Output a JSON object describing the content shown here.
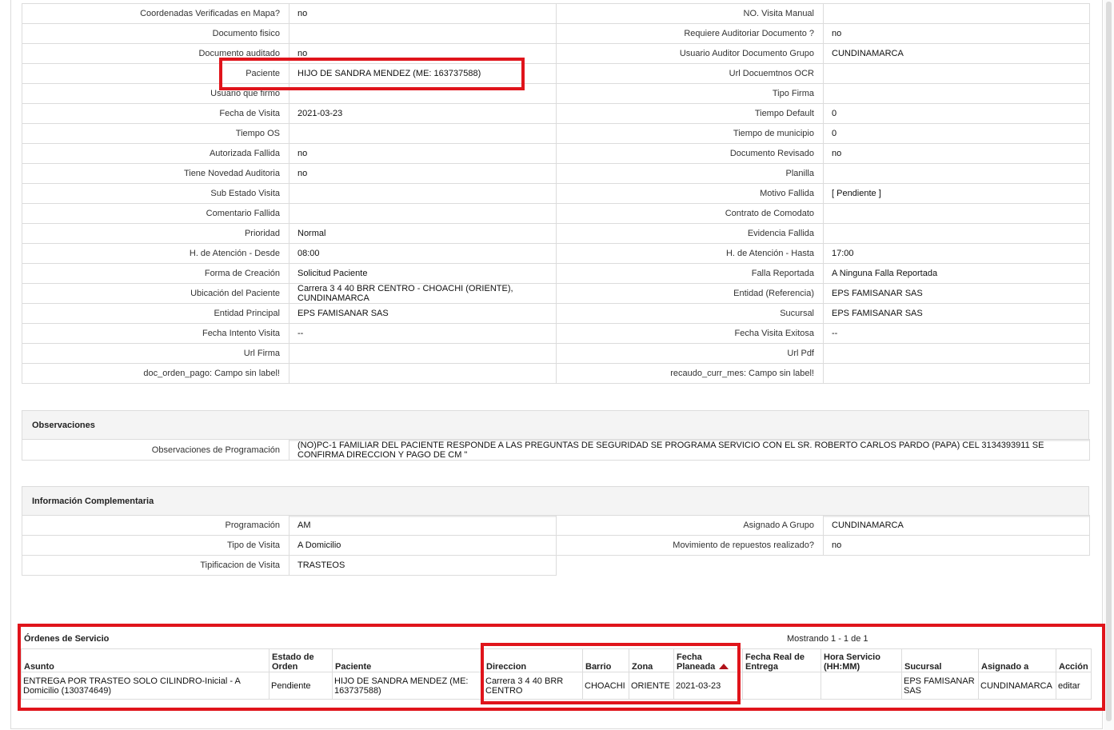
{
  "details": [
    {
      "l1": "Coordenadas Verificadas en Mapa?",
      "v1": "no",
      "l2": "NO. Visita Manual",
      "v2": ""
    },
    {
      "l1": "Documento fisico",
      "v1": "",
      "l2": "Requiere Auditoriar Documento ?",
      "v2": "no"
    },
    {
      "l1": "Documento auditado",
      "v1": "no",
      "l2": "Usuario Auditor Documento Grupo",
      "v2": "CUNDINAMARCA"
    },
    {
      "l1": "Paciente",
      "v1": "HIJO DE SANDRA MENDEZ (ME: 163737588)",
      "l2": "Url Docuemtnos OCR",
      "v2": ""
    },
    {
      "l1": "Usuario que firmo",
      "v1": "",
      "l2": "Tipo Firma",
      "v2": ""
    },
    {
      "l1": "Fecha de Visita",
      "v1": "2021-03-23",
      "l2": "Tiempo Default",
      "v2": "0"
    },
    {
      "l1": "Tiempo OS",
      "v1": "",
      "l2": "Tiempo de municipio",
      "v2": "0"
    },
    {
      "l1": "Autorizada Fallida",
      "v1": "no",
      "l2": "Documento Revisado",
      "v2": "no"
    },
    {
      "l1": "Tiene Novedad Auditoria",
      "v1": "no",
      "l2": "Planilla",
      "v2": ""
    },
    {
      "l1": "Sub Estado Visita",
      "v1": "",
      "l2": "Motivo Fallida",
      "v2": "[ Pendiente ]"
    },
    {
      "l1": "Comentario Fallida",
      "v1": "",
      "l2": "Contrato de Comodato",
      "v2": ""
    },
    {
      "l1": "Prioridad",
      "v1": "Normal",
      "l2": "Evidencia Fallida",
      "v2": ""
    },
    {
      "l1": "H. de Atención - Desde",
      "v1": "08:00",
      "l2": "H. de Atención - Hasta",
      "v2": "17:00"
    },
    {
      "l1": "Forma de Creación",
      "v1": "Solicitud Paciente",
      "l2": "Falla Reportada",
      "v2": "A Ninguna Falla Reportada"
    },
    {
      "l1": "Ubicación del Paciente",
      "v1": "Carrera 3 4 40 BRR CENTRO - CHOACHI (ORIENTE), CUNDINAMARCA",
      "l2": "Entidad (Referencia)",
      "v2": "EPS FAMISANAR SAS"
    },
    {
      "l1": "Entidad Principal",
      "v1": "EPS FAMISANAR SAS",
      "l2": "Sucursal",
      "v2": "EPS FAMISANAR SAS"
    },
    {
      "l1": "Fecha Intento Visita",
      "v1": "--",
      "l2": "Fecha Visita Exitosa",
      "v2": "--"
    },
    {
      "l1": "Url Firma",
      "v1": "",
      "l2": "Url Pdf",
      "v2": ""
    },
    {
      "l1": "doc_orden_pago: Campo sin label!",
      "v1": "",
      "l2": "recaudo_curr_mes: Campo sin label!",
      "v2": ""
    }
  ],
  "observaciones": {
    "title": "Observaciones",
    "label": "Observaciones de Programación",
    "value": "(NO)PC-1 FAMILIAR DEL PACIENTE RESPONDE A LAS PREGUNTAS DE SEGURIDAD SE PROGRAMA SERVICIO CON EL SR. ROBERTO CARLOS PARDO (PAPA) CEL 3134393911 SE CONFIRMA DIRECCION Y PAGO DE CM \""
  },
  "complementaria": {
    "title": "Información Complementaria",
    "rows": [
      {
        "l1": "Programación",
        "v1": "AM",
        "l2": "Asignado A Grupo",
        "v2": "CUNDINAMARCA"
      },
      {
        "l1": "Tipo de Visita",
        "v1": "A Domicilio",
        "l2": "Movimiento de repuestos realizado?",
        "v2": "no"
      },
      {
        "l1": "Tipificacion de Visita",
        "v1": "TRASTEOS"
      }
    ]
  },
  "ordenes": {
    "title": "Órdenes de Servicio",
    "count": "Mostrando 1 - 1 de 1",
    "columns": [
      "Asunto",
      "Estado de Orden",
      "Paciente",
      "Direccion",
      "Barrio",
      "Zona",
      "Fecha Planeada",
      "Fecha Real de Entrega",
      "Hora Servicio (HH:MM)",
      "Sucursal",
      "Asignado a",
      "Acción"
    ],
    "rows": [
      {
        "asunto": "ENTREGA POR TRASTEO SOLO CILINDRO-Inicial - A Domicilio (130374649)",
        "estado": "Pendiente",
        "paciente": "HIJO DE SANDRA MENDEZ (ME: 163737588)",
        "direccion": "Carrera 3 4 40 BRR CENTRO",
        "barrio": "CHOACHI",
        "zona": "ORIENTE",
        "fecha_planeada": "2021-03-23",
        "fecha_real": "",
        "hora": "",
        "sucursal": "EPS FAMISANAR SAS",
        "asignado": "CUNDINAMARCA",
        "accion": "editar"
      }
    ]
  },
  "colors": {
    "highlight": "#e0141b",
    "border": "#dcdcdc",
    "header_bg": "#f4f4f4",
    "sort_arrow": "#b0121a"
  }
}
